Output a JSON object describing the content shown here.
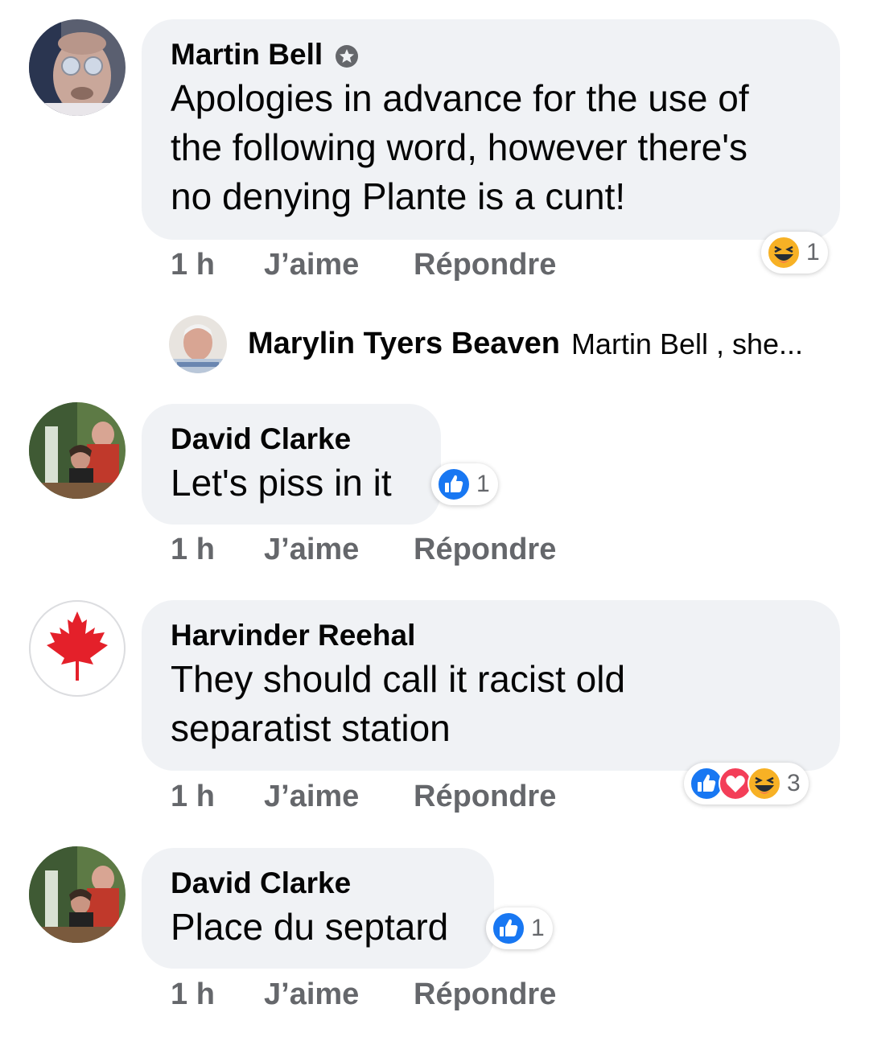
{
  "comments": [
    {
      "author": "Martin Bell",
      "text_lines": [
        "Apologies in advance for the use of",
        "the following word, however there's",
        "no denying Plante is a cunt!"
      ],
      "time": "1 h",
      "like_label": "J’aime",
      "reply_label": "Répondre",
      "reactions": [
        "haha"
      ],
      "reaction_count": "1"
    },
    {
      "author": "David Clarke",
      "text_lines": [
        "Let's piss in it"
      ],
      "time": "1 h",
      "like_label": "J’aime",
      "reply_label": "Répondre",
      "reactions": [
        "like"
      ],
      "reaction_count": "1"
    },
    {
      "author": "Harvinder Reehal",
      "text_lines": [
        "They should call it racist old",
        "separatist station"
      ],
      "time": "1 h",
      "like_label": "J’aime",
      "reply_label": "Répondre",
      "reactions": [
        "like",
        "love",
        "haha"
      ],
      "reaction_count": "3"
    },
    {
      "author": "David Clarke",
      "text_lines": [
        "Place du septard"
      ],
      "time": "1 h",
      "like_label": "J’aime",
      "reply_label": "Répondre",
      "reactions": [
        "like"
      ],
      "reaction_count": "1"
    }
  ],
  "reply_preview": {
    "author": "Marylin Tyers Beaven",
    "text": "Martin Bell , she..."
  },
  "icons": {
    "badge": "top-fan-badge-icon",
    "like": "like-reaction-icon",
    "love": "love-reaction-icon",
    "haha": "haha-reaction-icon"
  },
  "colors": {
    "bubble": "#f0f2f5",
    "secondary_text": "#65676b",
    "like_blue": "#1877f2",
    "love_red": "#f33e58",
    "haha_yellow": "#f7b125"
  }
}
